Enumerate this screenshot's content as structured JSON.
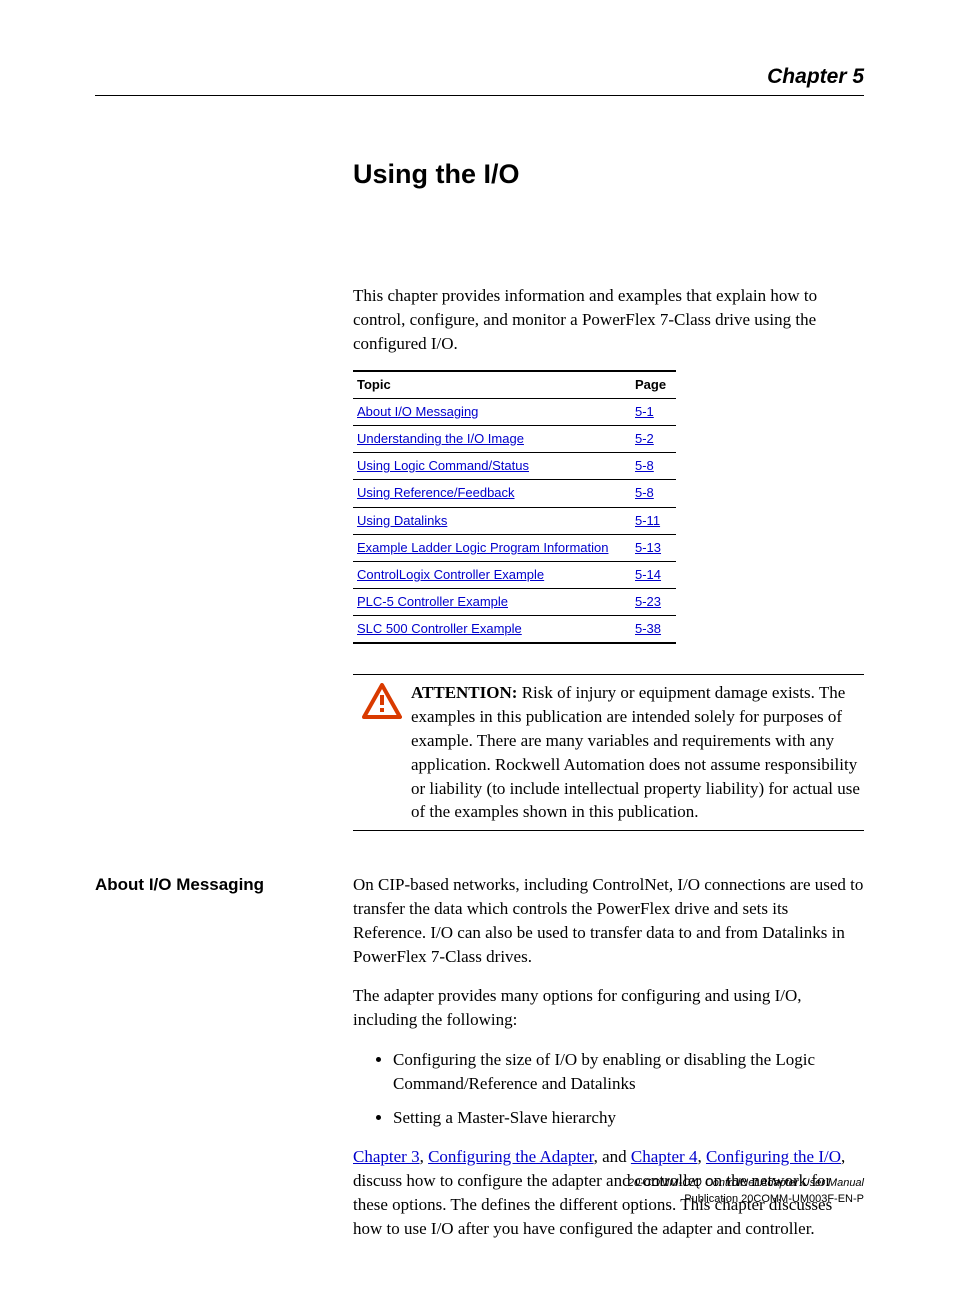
{
  "chapter_label": "Chapter 5",
  "title": "Using the I/O",
  "intro": "This chapter provides information and examples that explain how to control, configure, and monitor a PowerFlex 7-Class drive using the configured I/O.",
  "toc": {
    "headers": {
      "topic": "Topic",
      "page": "Page"
    },
    "rows": [
      {
        "topic": "About I/O Messaging",
        "page": "5-1"
      },
      {
        "topic": "Understanding the I/O Image",
        "page": "5-2"
      },
      {
        "topic": "Using Logic Command/Status",
        "page": "5-8"
      },
      {
        "topic": "Using Reference/Feedback",
        "page": "5-8"
      },
      {
        "topic": "Using Datalinks",
        "page": "5-11"
      },
      {
        "topic": "Example Ladder Logic Program Information",
        "page": "5-13"
      },
      {
        "topic": "ControlLogix Controller Example",
        "page": "5-14"
      },
      {
        "topic": "PLC-5 Controller Example",
        "page": "5-23"
      },
      {
        "topic": "SLC 500 Controller Example",
        "page": "5-38"
      }
    ]
  },
  "attention": {
    "label": "ATTENTION:",
    "text": "Risk of injury or equipment damage exists. The examples in this publication are intended solely for purposes of example. There are many variables and requirements with any application. Rockwell Automation does not assume responsibility or liability (to include intellectual property liability) for actual use of the examples shown in this publication."
  },
  "section": {
    "heading": "About I/O Messaging",
    "p1": "On CIP-based networks, including ControlNet, I/O connections are used to transfer the data which controls the PowerFlex drive and sets its Reference. I/O can also be used to transfer data to and from Datalinks in PowerFlex 7-Class drives.",
    "p2": "The adapter provides many options for configuring and using I/O, including the following:",
    "bullets": [
      "Configuring the size of I/O by enabling or disabling the Logic Command/Reference and Datalinks",
      "Setting a Master-Slave hierarchy"
    ],
    "p3": {
      "link1": "Chapter 3",
      "sep1": ", ",
      "link2": "Configuring the Adapter",
      "sep2": ", and ",
      "link3": "Chapter 4",
      "sep3": ", ",
      "link4": "Configuring the I/O",
      "tail": ", discuss how to configure the adapter and controller on the network for these options. The  defines the different options. This chapter discusses how to use I/O after you have configured the adapter and controller."
    }
  },
  "footer": {
    "manual": "20-COMM-C/Q ControlNet Adapter User Manual",
    "pub": "Publication 20COMM-UM003F-EN-P"
  }
}
